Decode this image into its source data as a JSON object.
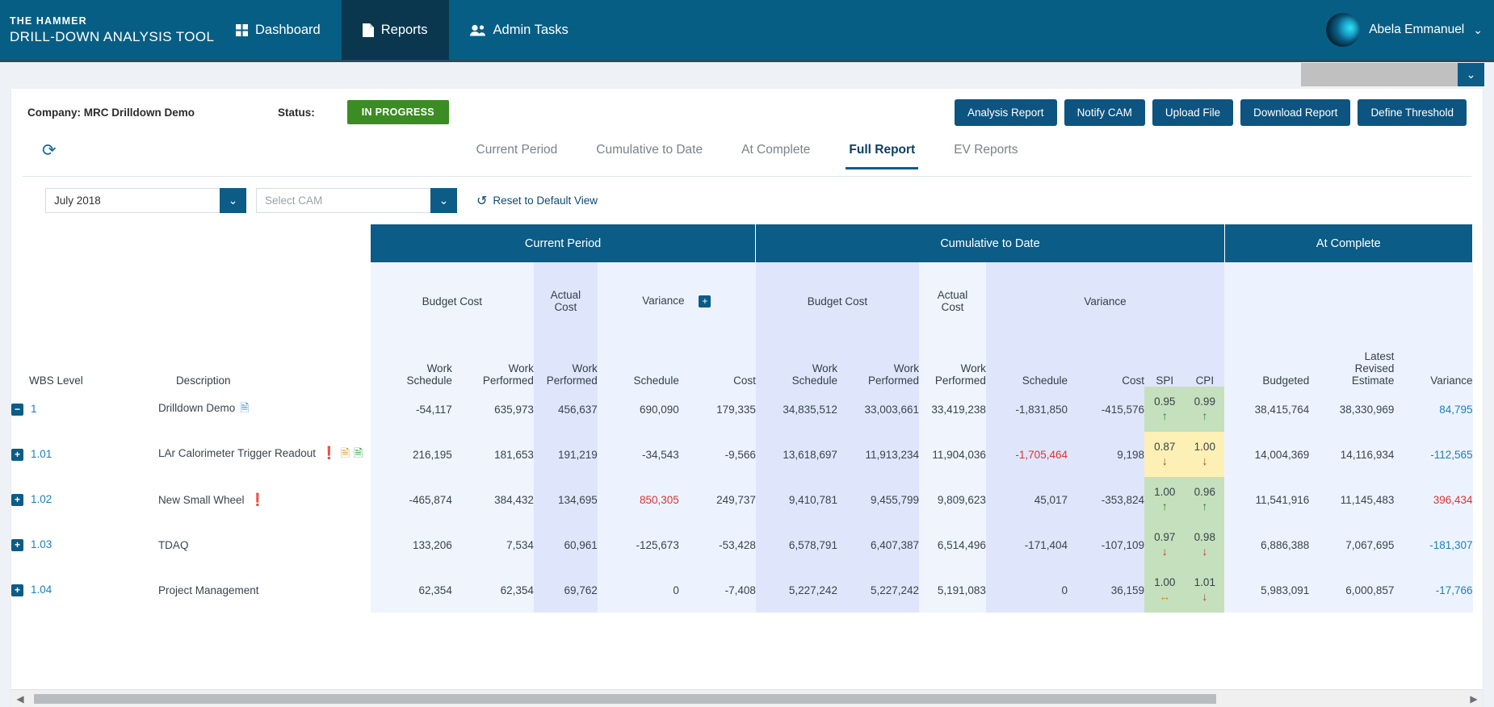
{
  "header": {
    "brand_top": "THE HAMMER",
    "brand_bottom": "DRILL-DOWN ANALYSIS TOOL",
    "nav": [
      {
        "label": "Dashboard",
        "icon": "grid-icon",
        "active": false
      },
      {
        "label": "Reports",
        "icon": "document-icon",
        "active": true
      },
      {
        "label": "Admin Tasks",
        "icon": "users-icon",
        "active": false
      }
    ],
    "user_name": "Abela Emmanuel",
    "user_caret": "⌄",
    "avatar": "user-avatar"
  },
  "subbar": {
    "select_caret": "⌄"
  },
  "toolbar": {
    "company": "Company: MRC Drilldown Demo",
    "status_label": "Status:",
    "status_value": "IN PROGRESS",
    "status_color": "#3b8c22",
    "buttons": [
      "Analysis Report",
      "Notify CAM",
      "Upload File",
      "Download Report",
      "Define Threshold"
    ]
  },
  "tabs": {
    "refresh_icon": "⟳",
    "items": [
      {
        "label": "Current Period",
        "active": false
      },
      {
        "label": "Cumulative to Date",
        "active": false
      },
      {
        "label": "At Complete",
        "active": false
      },
      {
        "label": "Full Report",
        "active": true
      },
      {
        "label": "EV Reports",
        "active": false
      }
    ]
  },
  "filters": {
    "period_value": "July 2018",
    "cam_placeholder": "Select CAM",
    "reset_label": "Reset to Default View",
    "reset_icon": "↺",
    "caret": "⌄"
  },
  "table": {
    "bands": [
      {
        "label": "Current Period"
      },
      {
        "label": "Cumulative to Date"
      },
      {
        "label": "At Complete"
      }
    ],
    "groups": {
      "cp_budget": "Budget Cost",
      "cp_actual": "Actual\nCost",
      "cp_actual_l1": "Actual",
      "cp_actual_l2": "Cost",
      "cp_variance": "Variance",
      "ctd_budget": "Budget Cost",
      "ctd_actual_l1": "Actual",
      "ctd_actual_l2": "Cost",
      "ctd_variance": "Variance",
      "expand_plus": "+"
    },
    "columns": [
      "WBS Level",
      "Description",
      "Work Schedule",
      "Work Performed",
      "Work Performed",
      "Schedule",
      "Cost",
      "Work Schedule",
      "Work Performed",
      "Work Performed",
      "Schedule",
      "Cost",
      "SPI",
      "CPI",
      "Budgeted",
      "Latest Revised Estimate",
      "Variance"
    ],
    "subheaders": {
      "wbs": "WBS Level",
      "desc": "Description",
      "work_l1": "Work",
      "sched_l2": "Schedule",
      "perf_l2": "Performed",
      "schedule": "Schedule",
      "cost": "Cost",
      "spi": "SPI",
      "cpi": "CPI",
      "budgeted": "Budgeted",
      "lre_l1": "Latest",
      "lre_l2": "Revised",
      "lre_l3": "Estimate",
      "variance": "Variance"
    },
    "rows": [
      {
        "wbs": "1",
        "expander": "−",
        "level": 0,
        "description": "Drilldown Demo",
        "icons": [
          "doc"
        ],
        "cp_bcws": "-54,117",
        "cp_bcwp": "635,973",
        "cp_acwp": "456,637",
        "cp_var_sched": "690,090",
        "cp_var_cost": "179,335",
        "ctd_bcws": "34,835,512",
        "ctd_bcwp": "33,003,661",
        "ctd_acwp": "33,419,238",
        "ctd_var_sched": "-1,831,850",
        "ctd_var_cost": "-415,576",
        "spi": "0.95",
        "spi_dir": "up",
        "cpi": "0.99",
        "cpi_dir": "up",
        "idx_color": "green",
        "budgeted": "38,415,764",
        "lre": "38,330,969",
        "ac_variance": "84,795",
        "ac_variance_style": "link"
      },
      {
        "wbs": "1.01",
        "expander": "+",
        "level": 1,
        "description": "LAr Calorimeter Trigger Readout",
        "icons": [
          "bang",
          "ydoc",
          "gchk"
        ],
        "cp_bcws": "216,195",
        "cp_bcwp": "181,653",
        "cp_acwp": "191,219",
        "cp_var_sched": "-34,543",
        "cp_var_cost": "-9,566",
        "ctd_bcws": "13,618,697",
        "ctd_bcwp": "11,913,234",
        "ctd_acwp": "11,904,036",
        "ctd_var_sched": "-1,705,464",
        "ctd_var_sched_style": "neg",
        "ctd_var_cost": "9,198",
        "spi": "0.87",
        "spi_dir": "down",
        "cpi": "1.00",
        "cpi_dir": "down",
        "idx_color": "yellow",
        "budgeted": "14,004,369",
        "lre": "14,116,934",
        "ac_variance": "-112,565",
        "ac_variance_style": "link"
      },
      {
        "wbs": "1.02",
        "expander": "+",
        "level": 1,
        "description": "New Small Wheel",
        "icons": [
          "bang"
        ],
        "cp_bcws": "-465,874",
        "cp_bcwp": "384,432",
        "cp_acwp": "134,695",
        "cp_var_sched": "850,305",
        "cp_var_sched_style": "neg",
        "cp_var_cost": "249,737",
        "ctd_bcws": "9,410,781",
        "ctd_bcwp": "9,455,799",
        "ctd_acwp": "9,809,623",
        "ctd_var_sched": "45,017",
        "ctd_var_cost": "-353,824",
        "spi": "1.00",
        "spi_dir": "up",
        "cpi": "0.96",
        "cpi_dir": "up",
        "idx_color": "green",
        "budgeted": "11,541,916",
        "lre": "11,145,483",
        "ac_variance": "396,434",
        "ac_variance_style": "neg"
      },
      {
        "wbs": "1.03",
        "expander": "+",
        "level": 1,
        "description": "TDAQ",
        "icons": [],
        "cp_bcws": "133,206",
        "cp_bcwp": "7,534",
        "cp_acwp": "60,961",
        "cp_var_sched": "-125,673",
        "cp_var_cost": "-53,428",
        "ctd_bcws": "6,578,791",
        "ctd_bcwp": "6,407,387",
        "ctd_acwp": "6,514,496",
        "ctd_var_sched": "-171,404",
        "ctd_var_cost": "-107,109",
        "spi": "0.97",
        "spi_dir": "down",
        "cpi": "0.98",
        "cpi_dir": "down",
        "idx_color": "green",
        "budgeted": "6,886,388",
        "lre": "7,067,695",
        "ac_variance": "-181,307",
        "ac_variance_style": "link"
      },
      {
        "wbs": "1.04",
        "expander": "+",
        "level": 1,
        "description": "Project Management",
        "icons": [],
        "cp_bcws": "62,354",
        "cp_bcwp": "62,354",
        "cp_acwp": "69,762",
        "cp_var_sched": "0",
        "cp_var_cost": "-7,408",
        "ctd_bcws": "5,227,242",
        "ctd_bcwp": "5,227,242",
        "ctd_acwp": "5,191,083",
        "ctd_var_sched": "0",
        "ctd_var_cost": "36,159",
        "spi": "1.00",
        "spi_dir": "flat",
        "cpi": "1.01",
        "cpi_dir": "down",
        "idx_color": "green",
        "budgeted": "5,983,091",
        "lre": "6,000,857",
        "ac_variance": "-17,766",
        "ac_variance_style": "link"
      }
    ]
  },
  "scrollbar": {
    "left_arrow": "◀",
    "right_arrow": "▶"
  }
}
